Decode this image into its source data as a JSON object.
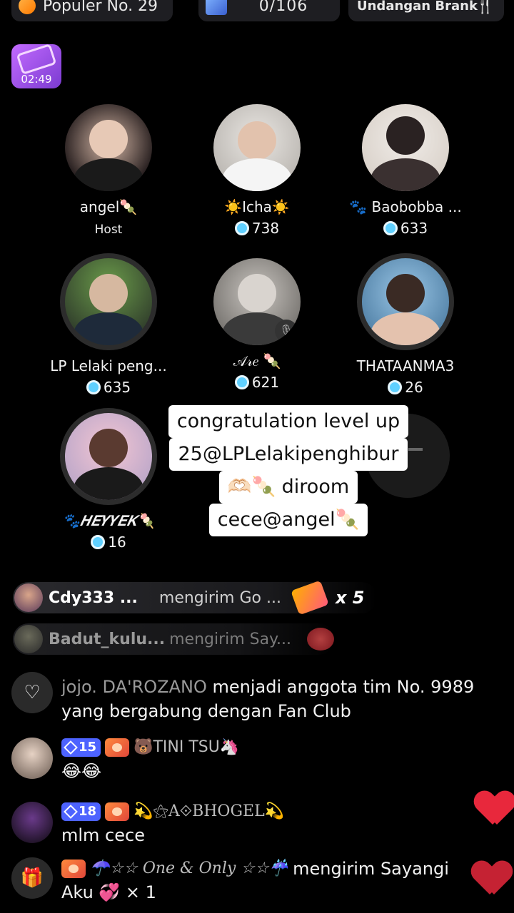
{
  "topbar": {
    "popular_label": "Populer No. 29",
    "game_count": "0/106",
    "invite_label": "Undangan Brank"
  },
  "timer": "02:49",
  "seats": [
    {
      "name": "angel🍡",
      "role": "Host"
    },
    {
      "name": "☀️Icha☀️",
      "score": "738"
    },
    {
      "name": "🐾 Baobobba ...",
      "score": "633"
    },
    {
      "name": "LP Lelaki peng...",
      "score": "635"
    },
    {
      "name": "𝒜𝓇𝑒 🍡",
      "score": "621"
    },
    {
      "name": "THATAANMA3",
      "score": "26"
    },
    {
      "name": "🐾𝑯𝑬𝒀𝒀𝑬𝑲🍡",
      "score": "16"
    }
  ],
  "caption": {
    "line1": "congratulation level up",
    "line2": "25@LPLelakipenghibur",
    "line3": "🫶🏻🍡 diroom",
    "line4": "cece@angel🍡"
  },
  "gift_banners": [
    {
      "user": "Cdy333 ...",
      "message": "mengirim Go ...",
      "multiplier": "x 5"
    },
    {
      "user": "Badut_kulu...",
      "message": "mengirim Say..."
    }
  ],
  "chat": [
    {
      "text_user": "jojo. DA'ROZANO",
      "text": " menjadi anggota tim No. 9989 yang bergabung dengan Fan Club"
    },
    {
      "level": "15",
      "name": "🐻TINI TSU🦄",
      "text": "😂😂"
    },
    {
      "level": "18",
      "name": "💫⚝A⟐BHOGEL💫",
      "text": "mlm cece"
    },
    {
      "name": "☂️☆☆ One & Only ☆☆☔",
      "text_after": " mengirim Sayangi",
      "text2": "Aku 💞 × 1"
    }
  ]
}
